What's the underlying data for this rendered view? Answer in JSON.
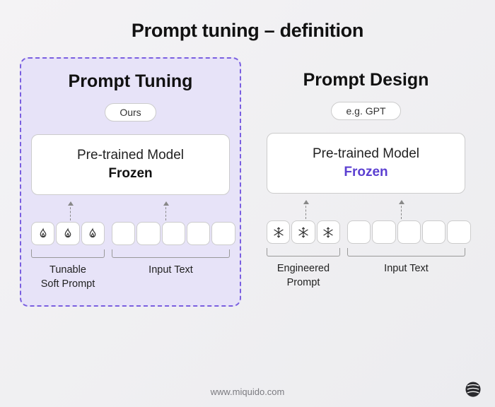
{
  "title": "Prompt tuning – definition",
  "left": {
    "heading": "Prompt Tuning",
    "pill": "Ours",
    "model_line1": "Pre-trained Model",
    "model_line2": "Frozen",
    "prompt_label": "Tunable\nSoft Prompt",
    "input_label": "Input Text",
    "prompt_icon": "fire",
    "prompt_token_count": 3,
    "input_token_count": 5
  },
  "right": {
    "heading": "Prompt Design",
    "pill": "e.g. GPT",
    "model_line1": "Pre-trained Model",
    "model_line2": "Frozen",
    "prompt_label": "Engineered\nPrompt",
    "input_label": "Input Text",
    "prompt_icon": "snowflake",
    "prompt_token_count": 3,
    "input_token_count": 5
  },
  "footer": "www.miquido.com"
}
